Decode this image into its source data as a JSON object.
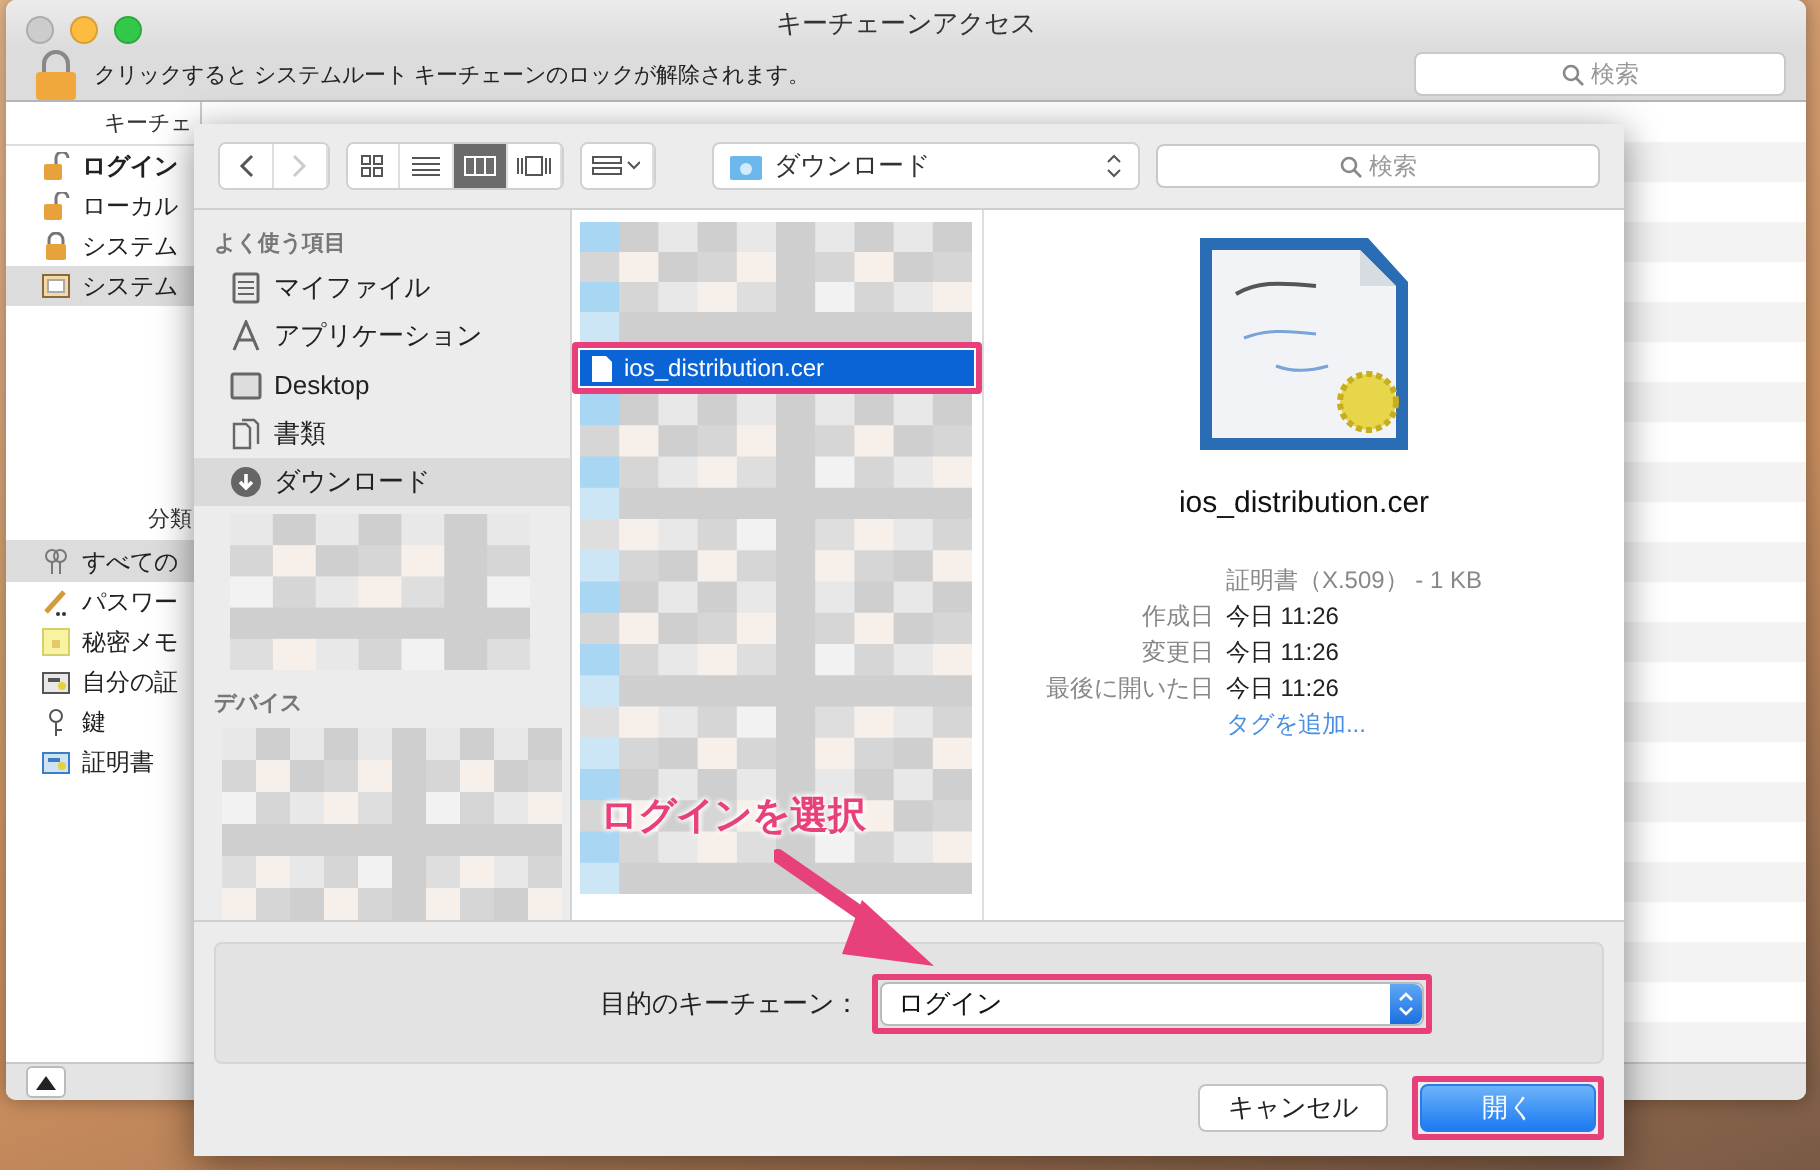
{
  "window": {
    "title": "キーチェーンアクセス"
  },
  "lock_bar": {
    "message": "クリックすると システムルート キーチェーンのロックが解除されます。",
    "search_placeholder": "検索"
  },
  "sidebar": {
    "keychains_header": "キーチェ",
    "keychains": [
      {
        "label": "ログイン",
        "kind": "unlocked",
        "bold": true,
        "selected": false
      },
      {
        "label": "ローカル",
        "kind": "unlocked",
        "bold": false,
        "selected": false
      },
      {
        "label": "システム",
        "kind": "locked",
        "bold": false,
        "selected": false
      },
      {
        "label": "システム",
        "kind": "cabinet",
        "bold": false,
        "selected": true
      }
    ],
    "category_header": "分類",
    "categories": [
      {
        "label": "すべての",
        "kind": "keys",
        "selected": true
      },
      {
        "label": "パスワー",
        "kind": "pencil",
        "selected": false
      },
      {
        "label": "秘密メモ",
        "kind": "note",
        "selected": false
      },
      {
        "label": "自分の証",
        "kind": "mycert",
        "selected": false
      },
      {
        "label": "鍵",
        "kind": "key",
        "selected": false
      },
      {
        "label": "証明書",
        "kind": "cert",
        "selected": false
      }
    ]
  },
  "dialog": {
    "toolbar": {
      "views": [
        {
          "kind": "icon",
          "selected": false
        },
        {
          "kind": "list",
          "selected": false
        },
        {
          "kind": "column",
          "selected": true
        },
        {
          "kind": "coverflow",
          "selected": false
        }
      ],
      "path": "ダウンロード",
      "search_placeholder": "検索"
    },
    "favorites_header": "よく使う項目",
    "favorites": [
      {
        "label": "マイファイル",
        "kind": "files",
        "selected": false
      },
      {
        "label": "アプリケーション",
        "kind": "apps",
        "selected": false
      },
      {
        "label": "Desktop",
        "kind": "desktop",
        "selected": false
      },
      {
        "label": "書類",
        "kind": "docs",
        "selected": false
      },
      {
        "label": "ダウンロード",
        "kind": "download",
        "selected": true
      }
    ],
    "devices_header": "デバイス",
    "file": {
      "name": "ios_distribution.cer",
      "selected": true,
      "highlighted": true
    },
    "preview": {
      "name": "ios_distribution.cer",
      "kind_size": "証明書（X.509） - 1 KB",
      "rows": [
        {
          "label": "作成日",
          "value": "今日 11:26"
        },
        {
          "label": "変更日",
          "value": "今日 11:26"
        },
        {
          "label": "最後に開いた日",
          "value": "今日 11:26"
        }
      ],
      "tag_link": "タグを追加..."
    },
    "keychain_label": "目的のキーチェーン：",
    "keychain_value": "ログイン",
    "keychain_highlighted": true,
    "buttons": [
      {
        "label": "キャンセル",
        "kind": "cancel",
        "highlighted": false
      },
      {
        "label": "開く",
        "kind": "default",
        "highlighted": true
      }
    ]
  },
  "annotation": {
    "text": "ログインを選択"
  }
}
